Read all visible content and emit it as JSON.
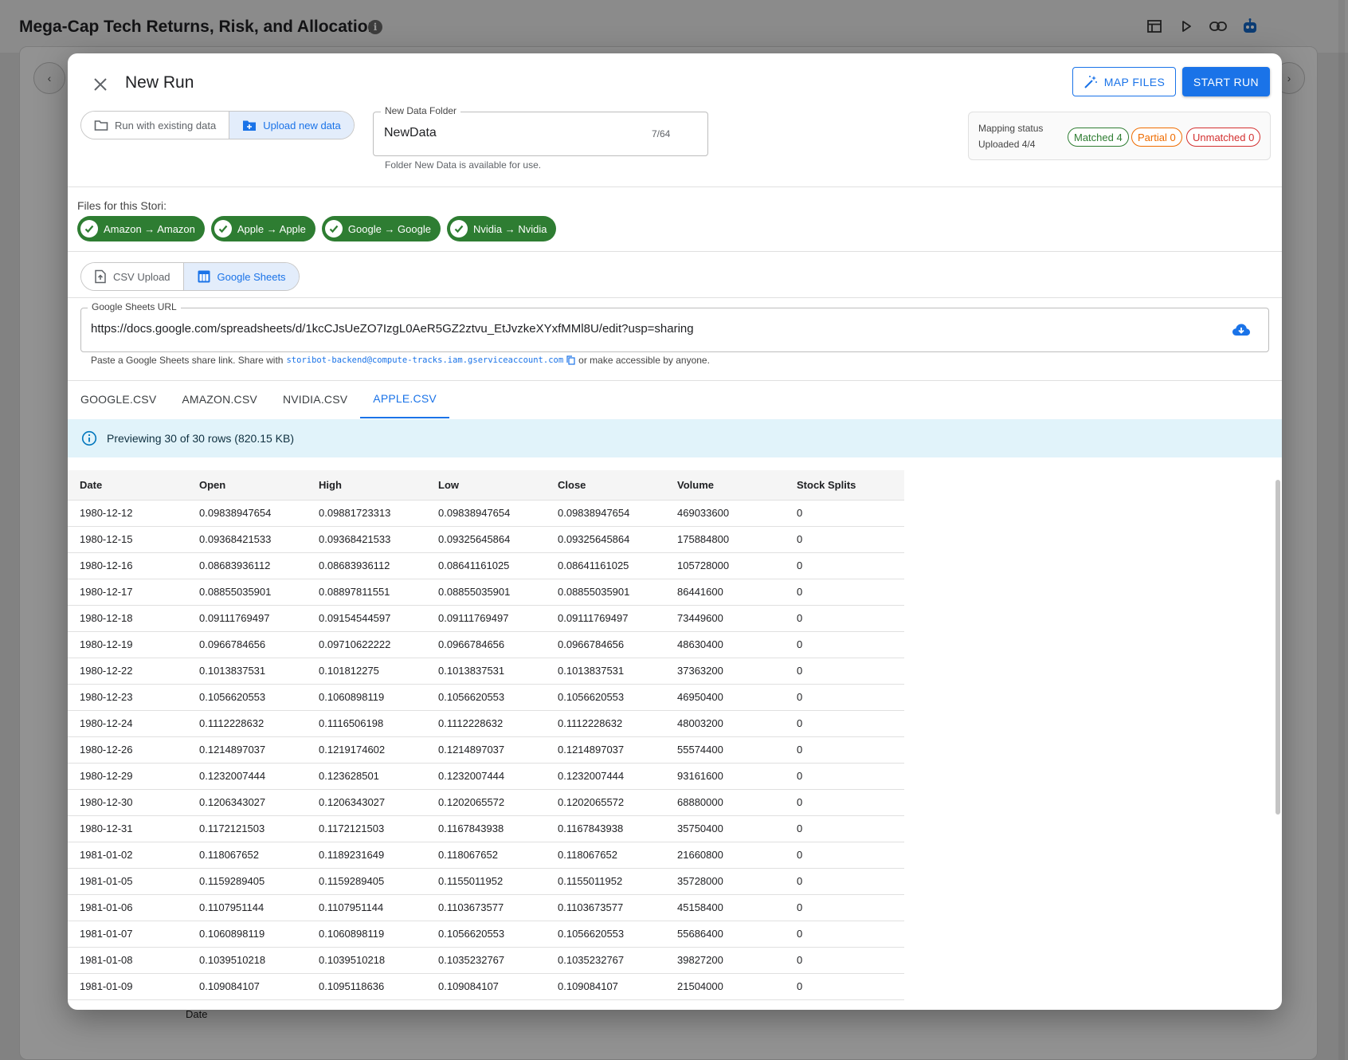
{
  "background": {
    "title": "Mega-Cap Tech Returns, Risk, and Allocation",
    "info_glyph": "i",
    "tool_icons": [
      "table-icon",
      "play-icon",
      "link-icon",
      "robot-icon"
    ],
    "axis_label": "Date"
  },
  "modal": {
    "title": "New Run",
    "map_files_label": "MAP FILES",
    "start_run_label": "START RUN",
    "data_source": {
      "options": [
        {
          "label": "Run with existing data",
          "icon": "folder-icon",
          "active": false
        },
        {
          "label": "Upload new data",
          "icon": "folder-plus-icon",
          "active": true
        }
      ]
    },
    "new_folder": {
      "legend": "New Data Folder",
      "value": "NewData",
      "count": "7/64",
      "helper": "Folder New Data is available for use."
    },
    "mapping": {
      "label": "Mapping status",
      "uploaded": "Uploaded 4/4",
      "matched": "Matched 4",
      "partial": "Partial 0",
      "unmatched": "Unmatched 0"
    },
    "files": {
      "label": "Files for this Stori:",
      "chips": [
        "Amazon → Amazon",
        "Apple → Apple",
        "Google → Google",
        "Nvidia → Nvidia"
      ]
    },
    "upload_mode": {
      "options": [
        {
          "label": "CSV Upload",
          "icon": "file-upload-icon",
          "active": false
        },
        {
          "label": "Google Sheets",
          "icon": "sheets-icon",
          "active": true
        }
      ]
    },
    "sheets_url": {
      "legend": "Google Sheets URL",
      "value": "https://docs.google.com/spreadsheets/d/1kcCJsUeZO7IzgL0AeR5GZ2ztvu_EtJvzkeXYxfMMl8U/edit?usp=sharing",
      "help_prefix": "Paste a Google Sheets share link. Share with",
      "email": "storibot-backend@compute-tracks.iam.gserviceaccount.com",
      "help_suffix": "or make accessible by anyone."
    },
    "tabs": [
      "GOOGLE.CSV",
      "AMAZON.CSV",
      "NVIDIA.CSV",
      "APPLE.CSV"
    ],
    "active_tab": 3,
    "preview_info": "Previewing 30 of 30 rows (820.15 KB)",
    "table": {
      "columns": [
        "Date",
        "Open",
        "High",
        "Low",
        "Close",
        "Volume",
        "Stock Splits"
      ],
      "rows": [
        [
          "1980-12-12",
          "0.09838947654",
          "0.09881723313",
          "0.09838947654",
          "0.09838947654",
          "469033600",
          "0"
        ],
        [
          "1980-12-15",
          "0.09368421533",
          "0.09368421533",
          "0.09325645864",
          "0.09325645864",
          "175884800",
          "0"
        ],
        [
          "1980-12-16",
          "0.08683936112",
          "0.08683936112",
          "0.08641161025",
          "0.08641161025",
          "105728000",
          "0"
        ],
        [
          "1980-12-17",
          "0.08855035901",
          "0.08897811551",
          "0.08855035901",
          "0.08855035901",
          "86441600",
          "0"
        ],
        [
          "1980-12-18",
          "0.09111769497",
          "0.09154544597",
          "0.09111769497",
          "0.09111769497",
          "73449600",
          "0"
        ],
        [
          "1980-12-19",
          "0.0966784656",
          "0.09710622222",
          "0.0966784656",
          "0.0966784656",
          "48630400",
          "0"
        ],
        [
          "1980-12-22",
          "0.1013837531",
          "0.101812275",
          "0.1013837531",
          "0.1013837531",
          "37363200",
          "0"
        ],
        [
          "1980-12-23",
          "0.1056620553",
          "0.1060898119",
          "0.1056620553",
          "0.1056620553",
          "46950400",
          "0"
        ],
        [
          "1980-12-24",
          "0.1112228632",
          "0.1116506198",
          "0.1112228632",
          "0.1112228632",
          "48003200",
          "0"
        ],
        [
          "1980-12-26",
          "0.1214897037",
          "0.1219174602",
          "0.1214897037",
          "0.1214897037",
          "55574400",
          "0"
        ],
        [
          "1980-12-29",
          "0.1232007444",
          "0.123628501",
          "0.1232007444",
          "0.1232007444",
          "93161600",
          "0"
        ],
        [
          "1980-12-30",
          "0.1206343027",
          "0.1206343027",
          "0.1202065572",
          "0.1202065572",
          "68880000",
          "0"
        ],
        [
          "1980-12-31",
          "0.1172121503",
          "0.1172121503",
          "0.1167843938",
          "0.1167843938",
          "35750400",
          "0"
        ],
        [
          "1981-01-02",
          "0.118067652",
          "0.1189231649",
          "0.118067652",
          "0.118067652",
          "21660800",
          "0"
        ],
        [
          "1981-01-05",
          "0.1159289405",
          "0.1159289405",
          "0.1155011952",
          "0.1155011952",
          "35728000",
          "0"
        ],
        [
          "1981-01-06",
          "0.1107951144",
          "0.1107951144",
          "0.1103673577",
          "0.1103673577",
          "45158400",
          "0"
        ],
        [
          "1981-01-07",
          "0.1060898119",
          "0.1060898119",
          "0.1056620553",
          "0.1056620553",
          "55686400",
          "0"
        ],
        [
          "1981-01-08",
          "0.1039510218",
          "0.1039510218",
          "0.1035232767",
          "0.1035232767",
          "39827200",
          "0"
        ],
        [
          "1981-01-09",
          "0.109084107",
          "0.1095118636",
          "0.109084107",
          "0.109084107",
          "21504000",
          "0"
        ]
      ]
    },
    "colors": {
      "accent": "#1a73e8",
      "success": "#2e7d32",
      "warning": "#ef6c00",
      "error": "#d32f2f",
      "info_bg": "#e1f3fa"
    }
  }
}
